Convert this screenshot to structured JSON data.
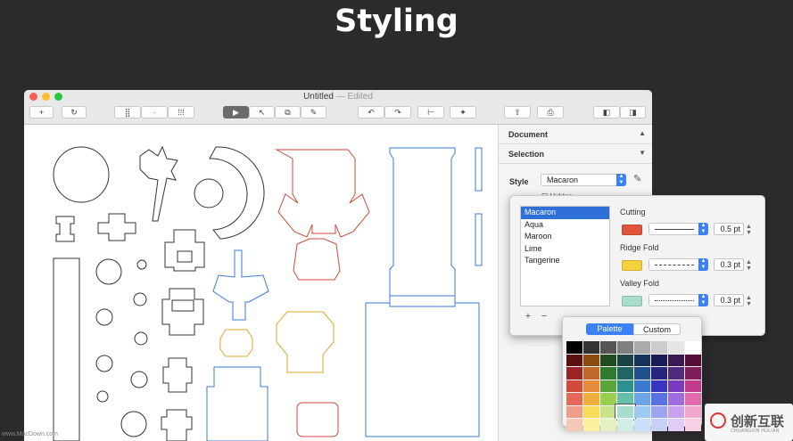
{
  "heading": "Styling",
  "window": {
    "title": "Untitled",
    "edited": "— Edited"
  },
  "toolbar": {
    "buttons": [
      {
        "name": "add-button",
        "glyph": "+"
      },
      {
        "name": "refresh-button",
        "glyph": "↻"
      },
      {
        "name": "grid-view-button",
        "glyph": "⣿"
      },
      {
        "name": "dot-view-button",
        "glyph": "·"
      },
      {
        "name": "dense-grid-button",
        "glyph": "⁞⁞⁞"
      },
      {
        "name": "select-tool-button",
        "glyph": "▶"
      },
      {
        "name": "direct-select-button",
        "glyph": "↖"
      },
      {
        "name": "scale-tool-button",
        "glyph": "⧉"
      },
      {
        "name": "pen-tool-button",
        "glyph": "✎"
      },
      {
        "name": "rotate-left-button",
        "glyph": "↶"
      },
      {
        "name": "rotate-right-button",
        "glyph": "↷"
      },
      {
        "name": "align-button",
        "glyph": "⊢"
      },
      {
        "name": "magic-wand-button",
        "glyph": "✦"
      },
      {
        "name": "share-button",
        "glyph": "⇧"
      },
      {
        "name": "print-button",
        "glyph": "⎙"
      },
      {
        "name": "left-sidebar-button",
        "glyph": "◧"
      },
      {
        "name": "right-sidebar-button",
        "glyph": "◨"
      }
    ]
  },
  "sidebar": {
    "document_label": "Document",
    "selection_label": "Selection",
    "style_label": "Style",
    "style_value": "Macaron",
    "hidden_label": "Hidden"
  },
  "popover": {
    "styles": [
      "Macaron",
      "Aqua",
      "Maroon",
      "Lime",
      "Tangerine"
    ],
    "selected_style": "Macaron",
    "cutting": {
      "label": "Cutting",
      "color": "#e0553c",
      "value": "0.5 pt"
    },
    "ridge": {
      "label": "Ridge Fold",
      "color": "#f4d03f",
      "value": "0.3 pt"
    },
    "valley": {
      "label": "Valley Fold",
      "color": "#a8dccd",
      "value": "0.3 pt"
    }
  },
  "picker": {
    "tab_palette": "Palette",
    "tab_custom": "Custom",
    "colors": [
      "#000000",
      "#333333",
      "#555555",
      "#7f7f7f",
      "#aaaaaa",
      "#cccccc",
      "#e6e6e6",
      "#ffffff",
      "#5a1010",
      "#8a4a10",
      "#1f4d1f",
      "#1b4242",
      "#16335c",
      "#1a1a55",
      "#3a1a55",
      "#55103a",
      "#9c2323",
      "#c0672a",
      "#2e7a2e",
      "#216464",
      "#1f4f8c",
      "#25257f",
      "#522a7f",
      "#7f1f5a",
      "#d24a3a",
      "#e78a3a",
      "#5aa53a",
      "#2f9090",
      "#3a7ad0",
      "#3535c0",
      "#7a3ac0",
      "#c03a8a",
      "#e46a5a",
      "#f0b040",
      "#9ad050",
      "#66c0a8",
      "#6aa5e5",
      "#5a70e0",
      "#a06ae0",
      "#e06aaa",
      "#ef9c88",
      "#f7dc5a",
      "#c8e48a",
      "#a8dccd",
      "#9ccaf2",
      "#9aa5ee",
      "#c8a0ee",
      "#f0a8cc",
      "#f5c8b8",
      "#faf0a0",
      "#e4f0c0",
      "#d0eee5",
      "#c8e0f8",
      "#c8d0f5",
      "#e0ccf5",
      "#f7d0e4"
    ],
    "selected_index": 43
  },
  "watermark": "www.MacDown.com",
  "logo": {
    "text": "创新互联",
    "sub": "CHUANGXIN HULIAN"
  }
}
